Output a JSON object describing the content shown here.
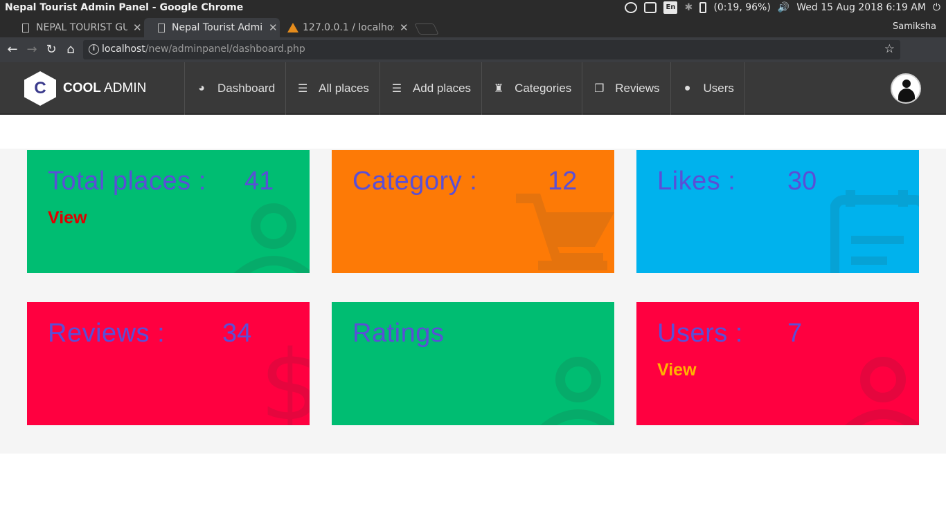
{
  "os": {
    "window_title": "Nepal Tourist Admin Panel - Google Chrome",
    "battery": "(0:19, 96%)",
    "keyboard": "En",
    "datetime": "Wed 15 Aug 2018  6:19 AM"
  },
  "browser": {
    "tabs": [
      {
        "label": "NEPAL TOURIST GU",
        "active": false
      },
      {
        "label": "Nepal Tourist Admi",
        "active": true
      },
      {
        "label": "127.0.0.1 / localhost",
        "active": false
      }
    ],
    "profile": "Samiksha",
    "url_host": "localhost",
    "url_path": "/new/adminpanel/dashboard.php"
  },
  "app": {
    "logo_letter": "C",
    "logo_bold": "COOL",
    "logo_rest": " ADMIN",
    "nav": [
      {
        "label": "Dashboard",
        "icon": "tachometer-icon"
      },
      {
        "label": "All places",
        "icon": "list-icon"
      },
      {
        "label": "Add places",
        "icon": "list-icon"
      },
      {
        "label": "Categories",
        "icon": "trophy-icon"
      },
      {
        "label": "Reviews",
        "icon": "files-icon"
      },
      {
        "label": "Users",
        "icon": "user-icon"
      }
    ]
  },
  "cards": {
    "total_places": {
      "title": "Total places :",
      "value": "41",
      "view": "View",
      "view_color": "#e00000"
    },
    "category": {
      "title": "Category :",
      "value": "12"
    },
    "likes": {
      "title": "Likes :",
      "value": "30"
    },
    "reviews": {
      "title": "Reviews :",
      "value": "34"
    },
    "ratings": {
      "title": "Ratings"
    },
    "users": {
      "title": "Users :",
      "value": "7",
      "view": "View",
      "view_color": "#ffb300"
    }
  },
  "colors": {
    "green": "#00bd72",
    "orange": "#fd7a06",
    "blue": "#00b2ed",
    "red": "#ff0040",
    "card_text": "#5a4fd6"
  }
}
